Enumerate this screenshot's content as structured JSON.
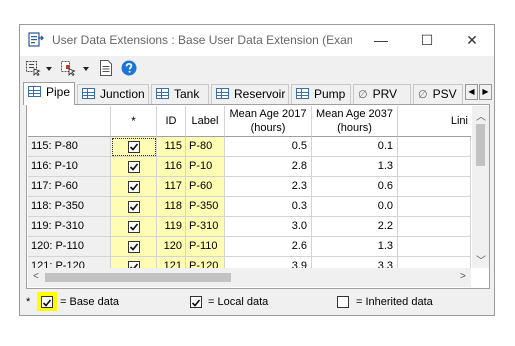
{
  "window": {
    "title": "User Data Extensions : Base User Data Extension (Exampl...",
    "minimize_glyph": "—",
    "maximize_glyph": "☐",
    "close_glyph": "✕"
  },
  "toolbar": {
    "items": [
      "select-icon",
      "filter-icon",
      "report-icon",
      "help-icon"
    ]
  },
  "tabs": [
    {
      "label": "Pipe",
      "icon": "table-icon",
      "active": true
    },
    {
      "label": "Junction",
      "icon": "table-icon",
      "active": false
    },
    {
      "label": "Tank",
      "icon": "table-icon",
      "active": false
    },
    {
      "label": "Reservoir",
      "icon": "table-icon",
      "active": false
    },
    {
      "label": "Pump",
      "icon": "table-icon",
      "active": false
    },
    {
      "label": "PRV",
      "icon": "diameter-icon",
      "active": false
    },
    {
      "label": "PSV",
      "icon": "diameter-icon",
      "active": false
    }
  ],
  "grid": {
    "columns": {
      "star": "*",
      "id": "ID",
      "label": "Label",
      "mean_2017": "Mean Age 2017 (hours)",
      "mean_2037": "Mean Age 2037 (hours)",
      "more": "Lini"
    },
    "rows": [
      {
        "row_label": "115: P-80",
        "checked": true,
        "id": "115",
        "label": "P-80",
        "mean_2017": "0.5",
        "mean_2037": "0.1"
      },
      {
        "row_label": "116: P-10",
        "checked": true,
        "id": "116",
        "label": "P-10",
        "mean_2017": "2.8",
        "mean_2037": "1.3"
      },
      {
        "row_label": "117: P-60",
        "checked": true,
        "id": "117",
        "label": "P-60",
        "mean_2017": "2.3",
        "mean_2037": "0.6"
      },
      {
        "row_label": "118: P-350",
        "checked": true,
        "id": "118",
        "label": "P-350",
        "mean_2017": "0.3",
        "mean_2037": "0.0"
      },
      {
        "row_label": "119: P-310",
        "checked": true,
        "id": "119",
        "label": "P-310",
        "mean_2017": "3.0",
        "mean_2037": "2.2"
      },
      {
        "row_label": "120: P-110",
        "checked": true,
        "id": "120",
        "label": "P-110",
        "mean_2017": "2.6",
        "mean_2037": "1.3"
      },
      {
        "row_label": "121: P-120",
        "checked": true,
        "id": "121",
        "label": "P-120",
        "mean_2017": "3.9",
        "mean_2037": "3.3"
      }
    ]
  },
  "legend": {
    "star": "*",
    "base": "= Base data",
    "local": "= Local data",
    "inherited": "= Inherited data"
  },
  "colors": {
    "base_cell": "#fffdb4",
    "legend_highlight": "#ffff00",
    "help_blue": "#1e74d6"
  }
}
